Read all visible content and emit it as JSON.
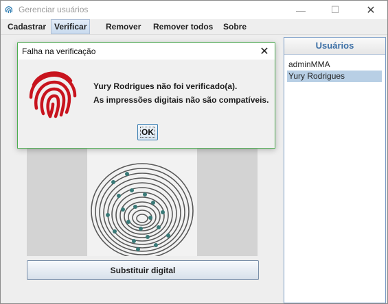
{
  "window": {
    "title": "Gerenciar usuários",
    "controls": {
      "minimize": "—",
      "maximize": "☐",
      "close": "✕"
    }
  },
  "menu": {
    "items": [
      "Cadastrar",
      "Verificar",
      "Remover",
      "Remover todos",
      "Sobre"
    ],
    "active": "Verificar"
  },
  "users_panel": {
    "header": "Usuários",
    "users": [
      "adminMMA",
      "Yury Rodrigues"
    ],
    "selected": "Yury Rodrigues"
  },
  "main": {
    "replace_button": "Substituir digital"
  },
  "dialog": {
    "title": "Falha na verificação",
    "close": "✕",
    "line1": "Yury Rodrigues não foi verificado(a).",
    "line2": "As impressões digitais não são compatíveis.",
    "ok": "OK",
    "icon": "fingerprint-icon"
  },
  "colors": {
    "accent": "#3a6ea5",
    "selection": "#b8cfe5",
    "fingerprint_red": "#c8141e",
    "minutiae": "#3a7a78",
    "dialog_border": "#4caf50"
  }
}
